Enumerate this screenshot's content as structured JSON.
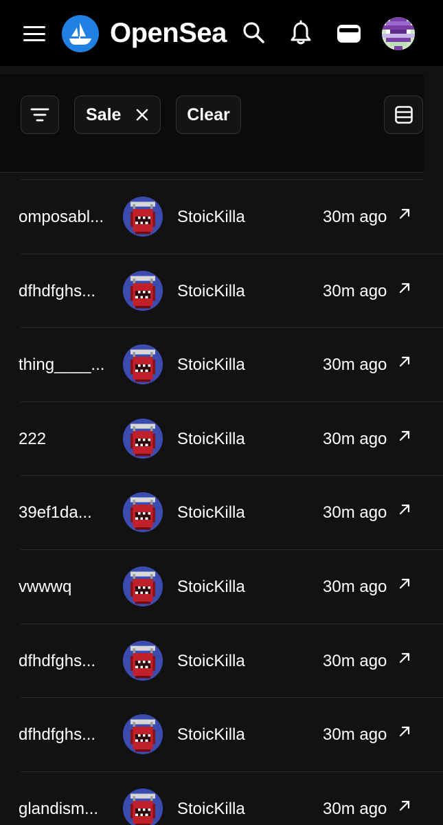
{
  "header": {
    "brand": "OpenSea",
    "icons": [
      "menu-icon",
      "opensea-logo",
      "search-icon",
      "bell-icon",
      "wallet-icon",
      "user-avatar"
    ]
  },
  "filters": {
    "chips": [
      {
        "icon": "filter-icon"
      },
      {
        "label": "Sale",
        "icon": "close-icon"
      },
      {
        "label": "Clear"
      },
      {
        "icon": "list-view-icon"
      }
    ]
  },
  "activity": {
    "rows": [
      {
        "item": "omposabl...",
        "user": "StoicKilla",
        "time": "30m ago"
      },
      {
        "item": "dfhdfghs...",
        "user": "StoicKilla",
        "time": "30m ago"
      },
      {
        "item": "thing____...",
        "user": "StoicKilla",
        "time": "30m ago"
      },
      {
        "item": "222",
        "user": "StoicKilla",
        "time": "30m ago"
      },
      {
        "item": "39ef1da...",
        "user": "StoicKilla",
        "time": "30m ago"
      },
      {
        "item": "vwwwq",
        "user": "StoicKilla",
        "time": "30m ago"
      },
      {
        "item": "dfhdfghs...",
        "user": "StoicKilla",
        "time": "30m ago"
      },
      {
        "item": "dfhdfghs...",
        "user": "StoicKilla",
        "time": "30m ago"
      },
      {
        "item": "glandism...",
        "user": "StoicKilla",
        "time": "30m ago"
      }
    ]
  },
  "colors": {
    "brand_blue": "#2081e2",
    "background": "#121212",
    "header_bg": "#000000",
    "avatar_bg": "#3b4bb0",
    "avatar_red": "#c0202a"
  }
}
